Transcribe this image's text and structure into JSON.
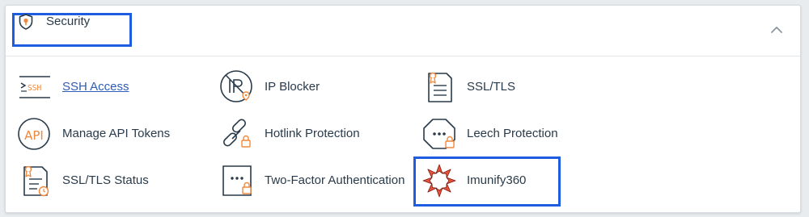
{
  "section": {
    "title": "Security",
    "title_icon": "shield-icon",
    "collapse_icon": "chevron-up-icon"
  },
  "items": [
    {
      "label": "SSH Access",
      "icon": "ssh-terminal-icon",
      "is_link": true
    },
    {
      "label": "IP Blocker",
      "icon": "ip-blocker-icon",
      "is_link": false
    },
    {
      "label": "SSL/TLS",
      "icon": "certificate-icon",
      "is_link": false
    },
    {
      "label": "Manage API Tokens",
      "icon": "api-icon",
      "is_link": false
    },
    {
      "label": "Hotlink Protection",
      "icon": "hotlink-chain-icon",
      "is_link": false
    },
    {
      "label": "Leech Protection",
      "icon": "leech-protection-icon",
      "is_link": false
    },
    {
      "label": "SSL/TLS Status",
      "icon": "certificate-status-icon",
      "is_link": false
    },
    {
      "label": "Two-Factor Authentication",
      "icon": "two-factor-icon",
      "is_link": false
    },
    {
      "label": "Imunify360",
      "icon": "imunify360-icon",
      "is_link": false
    }
  ],
  "colors": {
    "accent_orange": "#f0883c",
    "icon_dark": "#293a4a",
    "highlight_blue": "#1f5de0",
    "link_blue": "#2f5db3",
    "imunify_red": "#e8523a"
  }
}
